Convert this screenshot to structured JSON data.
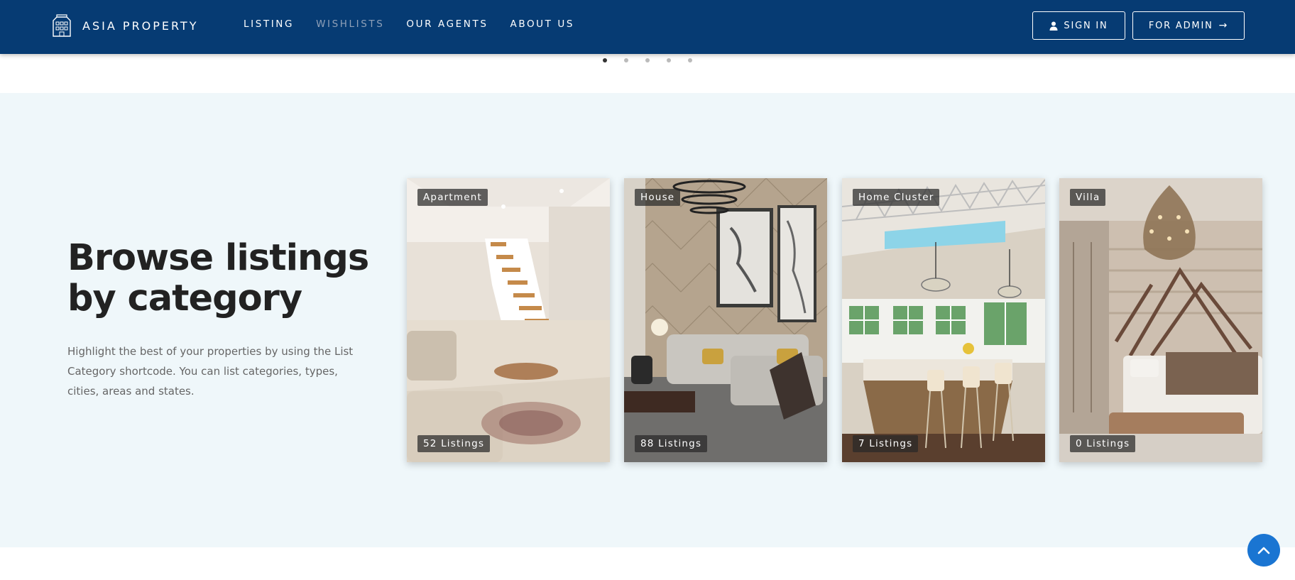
{
  "header": {
    "brand": "ASIA PROPERTY",
    "nav": [
      {
        "label": "LISTING"
      },
      {
        "label": "WISHLISTS"
      },
      {
        "label": "OUR AGENTS"
      },
      {
        "label": "ABOUT US"
      }
    ],
    "signin_label": "SIGN IN",
    "admin_label": "FOR ADMIN"
  },
  "carousel": {
    "dots": 5,
    "active": 0
  },
  "section": {
    "heading": "Browse listings by category",
    "description": "Highlight the best of your properties by using the List Category shortcode. You can list categories, types, cities, areas and states."
  },
  "categories": [
    {
      "name": "Apartment",
      "count": "52 Listings"
    },
    {
      "name": "House",
      "count": "88 Listings"
    },
    {
      "name": "Home Cluster",
      "count": "7 Listings"
    },
    {
      "name": "Villa",
      "count": "0 Listings"
    }
  ],
  "colors": {
    "header_bg": "#063b73",
    "section_bg": "#eff7fa",
    "accent": "#1a75d2"
  }
}
